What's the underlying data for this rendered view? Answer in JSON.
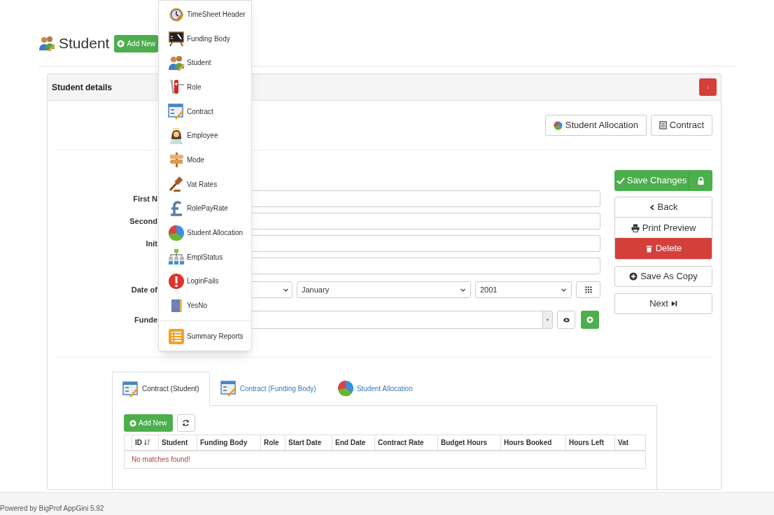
{
  "page": {
    "title": "Student",
    "add_new": "Add New"
  },
  "menu": {
    "items": [
      {
        "label": "TimeSheet Header"
      },
      {
        "label": "Funding Body"
      },
      {
        "label": "Student"
      },
      {
        "label": "Role"
      },
      {
        "label": "Contract"
      },
      {
        "label": "Employee"
      },
      {
        "label": "Mode"
      },
      {
        "label": "Vat Rates"
      },
      {
        "label": "RolePayRate"
      },
      {
        "label": "Student Allocation"
      },
      {
        "label": "EmplStatus"
      },
      {
        "label": "LoginFails"
      },
      {
        "label": "YesNo"
      }
    ],
    "footer_item": {
      "label": "Summary Reports"
    }
  },
  "panel": {
    "title": "Student details",
    "links": [
      "Student Allocation",
      "Contract"
    ]
  },
  "form": {
    "fields": [
      {
        "label": "First N",
        "kind": "text"
      },
      {
        "label": "Second",
        "kind": "text"
      },
      {
        "label": "Init",
        "kind": "text"
      },
      {
        "kind": "text"
      },
      {
        "label": "Date of",
        "kind": "date",
        "month": "January",
        "year": "2001"
      },
      {
        "label": "Funde",
        "kind": "lookup"
      }
    ]
  },
  "actions": {
    "save": "Save Changes",
    "back": "Back",
    "print": "Print Preview",
    "delete": "Delete",
    "save_copy": "Save As Copy",
    "next": "Next"
  },
  "tabs": [
    {
      "label": "Contract (Student)",
      "selected": true
    },
    {
      "label": "Contract (Funding Body)",
      "selected": false
    },
    {
      "label": "Student Allocation",
      "selected": false
    }
  ],
  "child": {
    "add_new": "Add New",
    "columns": [
      "ID",
      "Student",
      "Funding Body",
      "Role",
      "Start Date",
      "End Date",
      "Contract Rate",
      "Budget Hours",
      "Hours Booked",
      "Hours Left",
      "Vat"
    ],
    "empty_message": "No matches found!"
  },
  "footer": "Powered by BigProf AppGini 5.92"
}
